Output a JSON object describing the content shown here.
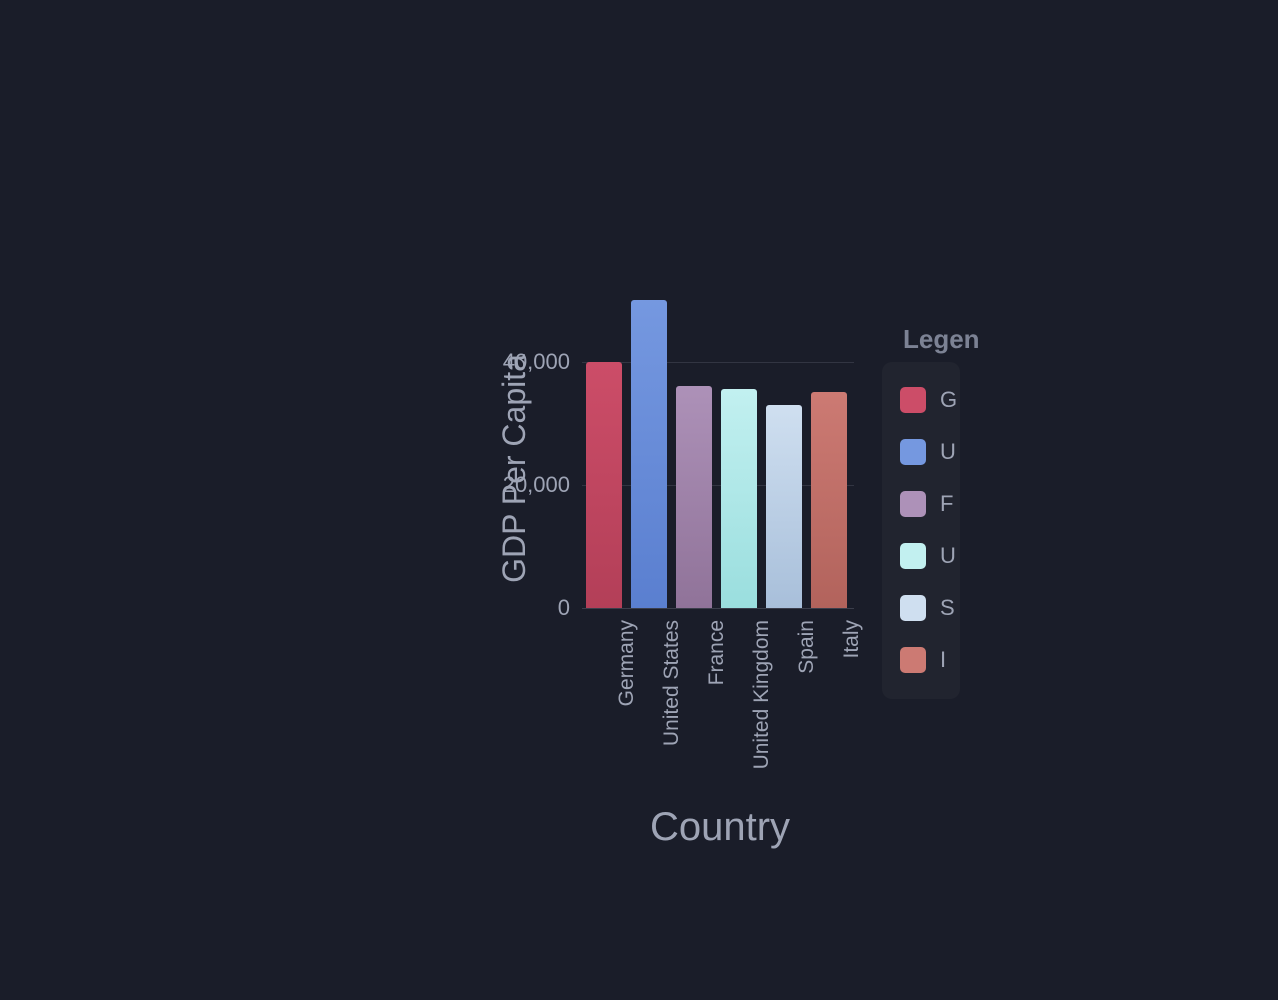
{
  "chart_data": {
    "type": "bar",
    "categories": [
      "Germany",
      "United States",
      "France",
      "United Kingdom",
      "Spain",
      "Italy"
    ],
    "values": [
      40000,
      50000,
      36000,
      35500,
      33000,
      35000
    ],
    "xlabel": "Country",
    "ylabel": "GDP Per Capita",
    "ylim": [
      0,
      50000
    ],
    "yticks": [
      0,
      20000,
      40000
    ],
    "ytick_labels": [
      "0",
      "20,000",
      "40,000"
    ],
    "colors": {
      "Germany": "#cc4d68",
      "United States": "#7598e0",
      "France": "#ad91b8",
      "United Kingdom": "#c2f0f0",
      "Spain": "#cfdff0",
      "Italy": "#cc7a73"
    }
  },
  "legend": {
    "title": "Legen",
    "items": [
      {
        "label": "G",
        "class": "germany"
      },
      {
        "label": "U",
        "class": "us"
      },
      {
        "label": "F",
        "class": "france"
      },
      {
        "label": "U",
        "class": "uk"
      },
      {
        "label": "S",
        "class": "spain"
      },
      {
        "label": "I",
        "class": "italy"
      }
    ]
  }
}
